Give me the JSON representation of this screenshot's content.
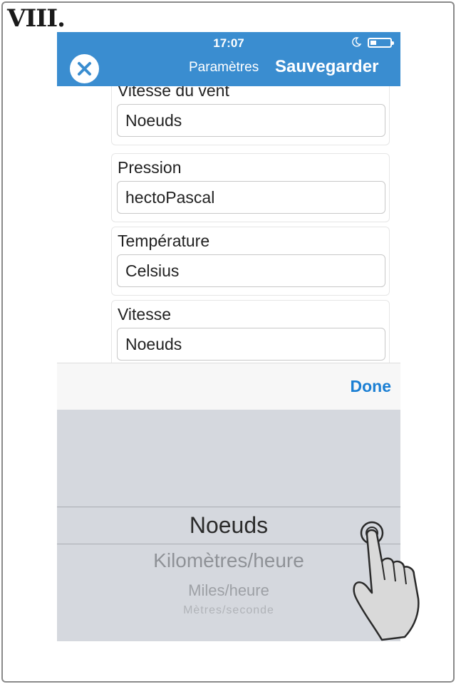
{
  "step_label": "VIII.",
  "status_bar": {
    "time": "17:07",
    "icons": [
      "moon-icon",
      "battery-icon"
    ]
  },
  "navbar": {
    "close_icon": "close-icon",
    "params_label": "Paramètres",
    "save_label": "Sauvegarder",
    "color": "#3a8dd0"
  },
  "settings": [
    {
      "label": "Vitesse du vent",
      "value": "Noeuds"
    },
    {
      "label": "Pression",
      "value": "hectoPascal"
    },
    {
      "label": "Température",
      "value": "Celsius"
    },
    {
      "label": "Vitesse",
      "value": "Noeuds"
    }
  ],
  "toolbar": {
    "done_label": "Done",
    "accent": "#1b7fd3"
  },
  "picker": {
    "selected": "Noeuds",
    "options": [
      "Noeuds",
      "Kilomètres/heure",
      "Miles/heure",
      "Mètres/seconde"
    ]
  },
  "overlay": {
    "hand_icon": "pointing-hand-icon"
  }
}
